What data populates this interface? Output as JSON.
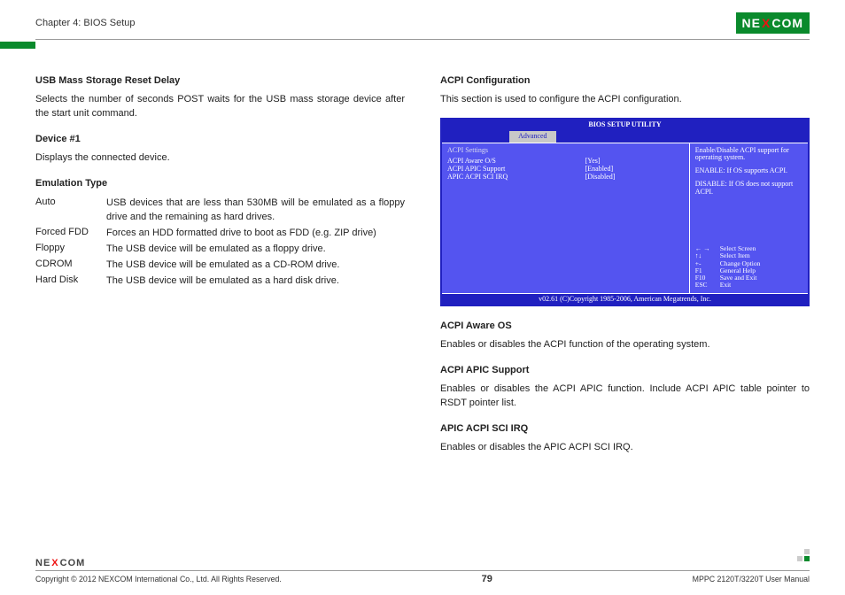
{
  "header": {
    "chapter": "Chapter 4: BIOS Setup",
    "logo_pre": "NE",
    "logo_x": "X",
    "logo_post": "COM"
  },
  "left": {
    "h1": "USB Mass Storage Reset Delay",
    "p1": "Selects the number of seconds POST waits for the USB mass storage device after the start unit command.",
    "h2": "Device #1",
    "p2": "Displays the connected device.",
    "h3": "Emulation Type",
    "rows": [
      {
        "k": "Auto",
        "v": "USB devices that are less than 530MB will be emulated as a floppy drive and the remaining as hard drives."
      },
      {
        "k": "Forced FDD",
        "v": "Forces an HDD formatted drive to boot as FDD (e.g. ZIP drive)"
      },
      {
        "k": "Floppy",
        "v": "The USB device will be emulated as a floppy drive."
      },
      {
        "k": "CDROM",
        "v": "The USB device will be emulated as a CD-ROM drive."
      },
      {
        "k": "Hard Disk",
        "v": "The USB device will be emulated as a hard disk drive."
      }
    ]
  },
  "right": {
    "h1": "ACPI Configuration",
    "p1": "This section is used to configure the ACPI configuration.",
    "h2": "ACPI Aware OS",
    "p2": "Enables or disables the ACPI function of the operating system.",
    "h3": "ACPI APIC Support",
    "p3": "Enables or disables the ACPI APIC function. Include ACPI APIC table pointer to RSDT pointer list.",
    "h4": "APIC ACPI SCI IRQ",
    "p4": "Enables or disables the APIC ACPI SCI IRQ."
  },
  "bios": {
    "title": "BIOS SETUP UTILITY",
    "tab": "Advanced",
    "section_label": "ACPI Settings",
    "rows": [
      {
        "k": "ACPI Aware O/S",
        "v": "[Yes]"
      },
      {
        "k": "ACPI APIC Support",
        "v": "[Enabled]"
      },
      {
        "k": "APIC ACPI SCI IRQ",
        "v": "[Disabled]"
      }
    ],
    "help1": "Enable/Disable ACPI support for operating system.",
    "help2": "ENABLE: If OS supports ACPI.",
    "help3": "DISABLE: If OS does not support ACPI.",
    "keys": [
      {
        "k": "← →",
        "v": "Select Screen"
      },
      {
        "k": "↑↓",
        "v": "Select Item"
      },
      {
        "k": "+-",
        "v": "Change Option"
      },
      {
        "k": "F1",
        "v": "General Help"
      },
      {
        "k": "F10",
        "v": "Save and Exit"
      },
      {
        "k": "ESC",
        "v": "Exit"
      }
    ],
    "footer": "v02.61 (C)Copyright 1985-2006, American Megatrends, Inc."
  },
  "footer": {
    "logo_pre": "NE",
    "logo_x": "X",
    "logo_post": "COM",
    "copyright": "Copyright © 2012 NEXCOM International Co., Ltd. All Rights Reserved.",
    "page": "79",
    "manual": "MPPC 2120T/3220T User Manual"
  }
}
